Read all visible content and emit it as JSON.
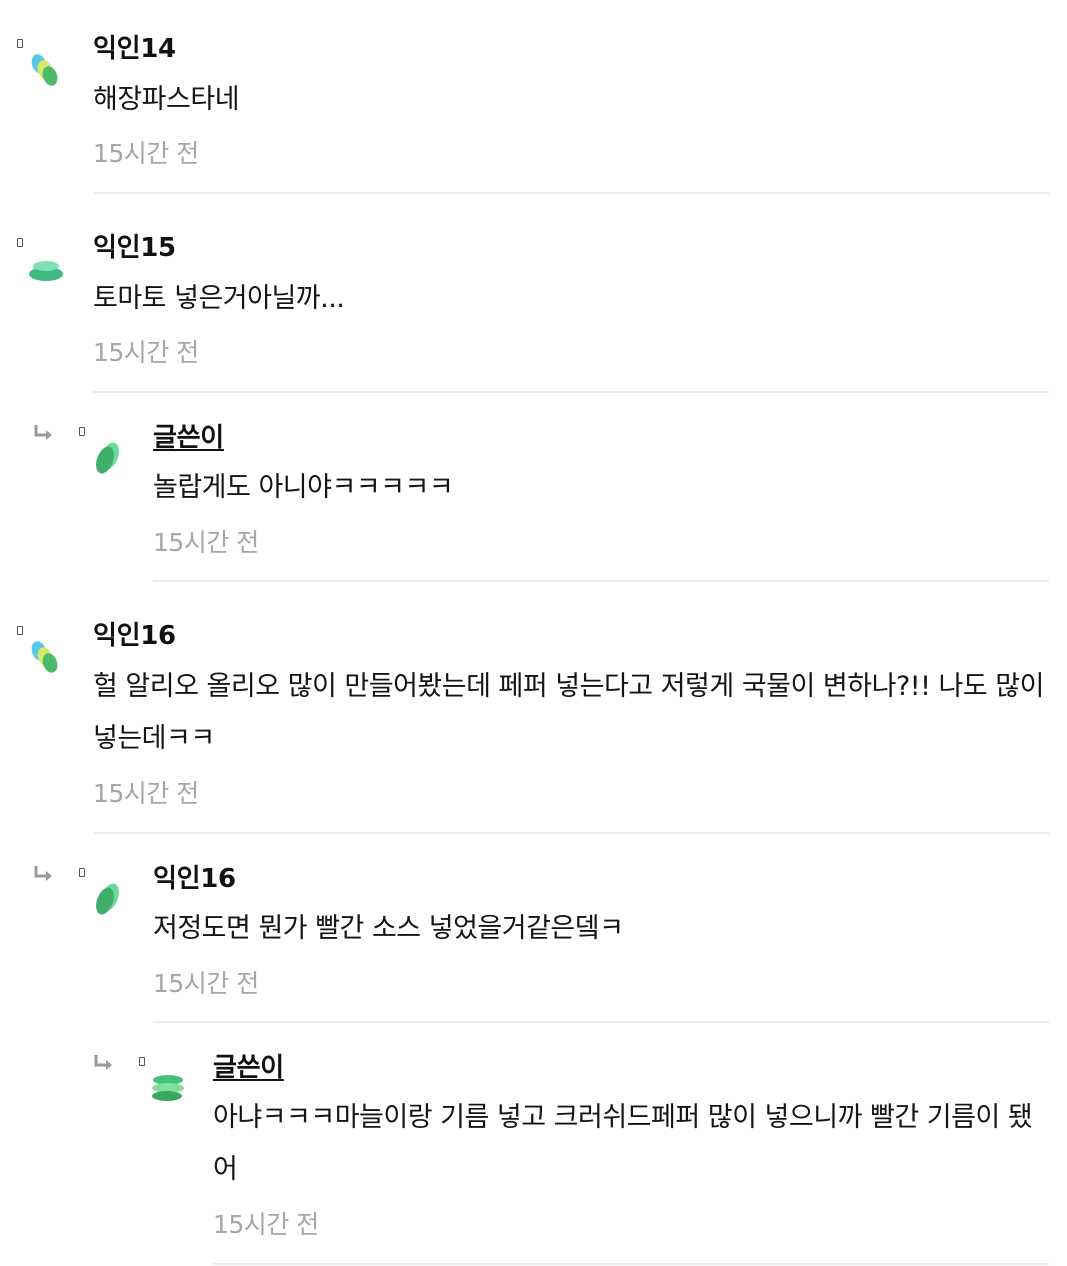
{
  "comments": [
    {
      "name": "익인14",
      "text": "해장파스타네",
      "time": "15시간 전"
    },
    {
      "name": "익인15",
      "text": "토마토 넣은거아닐까...",
      "time": "15시간 전"
    },
    {
      "name": "글쓴이",
      "text": "놀랍게도 아니야ㅋㅋㅋㅋㅋ",
      "time": "15시간 전"
    },
    {
      "name": "익인16",
      "text": "헐 알리오 올리오 많이 만들어봤는데 페퍼 넣는다고 저렇게 국물이 변하나?!! 나도 많이 넣는데ㅋㅋ",
      "time": "15시간 전"
    },
    {
      "name": "익인16",
      "text": "저정도면 뭔가 빨간 소스 넣었을거같은뎈ㅋ",
      "time": "15시간 전"
    },
    {
      "name": "글쓴이",
      "text": "아냐ㅋㅋㅋ마늘이랑 기름 넣고 크러쉬드페퍼 많이 넣으니까 빨간 기름이 됐어",
      "time": "15시간 전"
    }
  ],
  "colors": {
    "cyan": "#5bc8e8",
    "lime": "#d4ea6a",
    "green": "#4cba6a",
    "mint": "#66d9a0"
  },
  "icons": {
    "reply": "reply-arrow-icon",
    "avatar": "avatar-icon",
    "small": "small-icon"
  }
}
